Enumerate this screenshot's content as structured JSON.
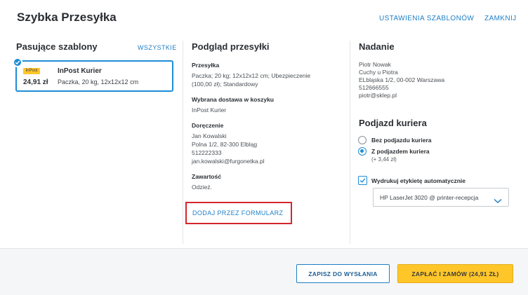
{
  "header": {
    "title": "Szybka Przesyłka",
    "templates_settings_label": "USTAWIENIA SZABLONÓW",
    "close_label": "ZAMKNIJ"
  },
  "templates": {
    "title": "Pasujące szablony",
    "all_label": "WSZYSTKIE",
    "items": [
      {
        "logo_text": "InPost",
        "name": "InPost Kurier",
        "price": "24,91 zł",
        "description": "Paczka, 20 kg, 12x12x12 cm",
        "selected": true
      }
    ]
  },
  "preview": {
    "title": "Podgląd przesyłki",
    "sections": [
      {
        "label": "Przesyłka",
        "lines": [
          "Paczka; 20 kg; 12x12x12 cm; Ubezpieczenie",
          "(100,00 zł); Standardowy"
        ]
      },
      {
        "label": "Wybrana dostawa w koszyku",
        "lines": [
          "InPost Kurier"
        ]
      },
      {
        "label": "Doręczenie",
        "lines": [
          "Jan Kowalski",
          "Polna 1/2, 82-300 Elbląg",
          "512222333",
          "jan.kowalski@furgonetka.pl"
        ]
      },
      {
        "label": "Zawartość",
        "lines": [
          "Odzież."
        ]
      }
    ],
    "add_form_label": "DODAJ PRZEZ FORMULARZ"
  },
  "sender": {
    "title": "Nadanie",
    "lines": [
      "Piotr Nowak",
      "Cuchy u Piotra",
      "ELbląska 1/2, 00-002 Warszawa",
      "512666555",
      "piotr@sklep.pl"
    ]
  },
  "pickup": {
    "title": "Podjazd kuriera",
    "options": [
      {
        "label": "Bez podjazdu kuriera",
        "sub": "",
        "selected": false
      },
      {
        "label": "Z podjazdem kuriera",
        "sub": "(+ 3,44 zł)",
        "selected": true
      }
    ]
  },
  "print": {
    "auto_label": "Wydrukuj etykietę automatycznie",
    "checked": true,
    "printer_value": "HP LaserJet 3020 @ printer-recepcja"
  },
  "footer": {
    "save_label": "ZAPISZ DO WYSŁANIA",
    "pay_label": "ZAPŁAĆ I ZAMÓW (24,91 ZŁ)"
  },
  "colors": {
    "accent": "#1e8cd6",
    "link": "#1e7fc6",
    "pay_button": "#ffc629",
    "highlight_border": "#d4262c"
  }
}
